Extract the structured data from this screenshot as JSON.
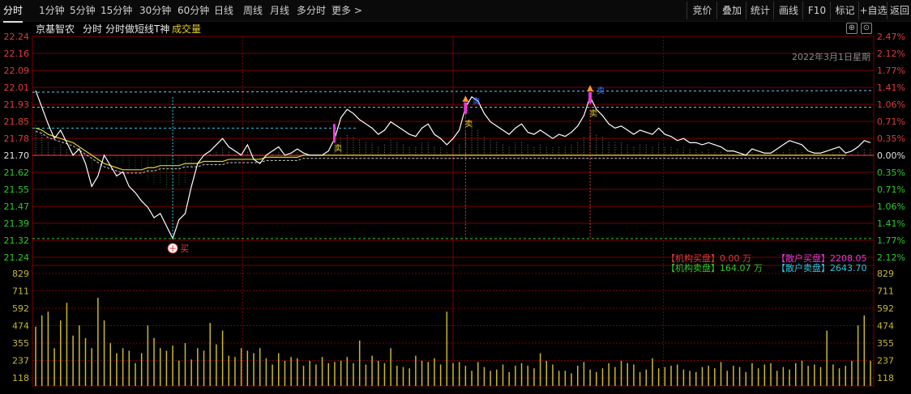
{
  "toolbar": {
    "tabs": [
      "分时",
      "1分钟",
      "5分钟",
      "15分钟",
      "30分钟",
      "60分钟",
      "日线",
      "周线",
      "月线",
      "多分时",
      "更多 >"
    ],
    "buttons": [
      "竞价",
      "叠加",
      "统计",
      "画线",
      "F10",
      "标记",
      "+自选",
      "返回"
    ]
  },
  "info": {
    "stock_name": "京基智农",
    "mode": "分时",
    "indicator": "分时做短线T神",
    "volume_label": "成交量"
  },
  "date_label": "2022年3月1日星期",
  "legend": {
    "inst_buy": "【机构买盘】0.00 万",
    "retail_buy": "【散户买盘】2208.05",
    "inst_sell": "【机构卖盘】164.07 万",
    "retail_sell": "【散户卖盘】2643.70"
  },
  "markers": {
    "buy": "买",
    "sell": "卖",
    "sell_caption": "卖"
  },
  "colors": {
    "up": "#e03c3c",
    "down": "#2ec82e",
    "price_line": "#ffffff",
    "avg_line": "#e8d020",
    "volume": "#c8b832",
    "grid": "#7a0000",
    "accent": "#e83ad8",
    "blue_mark": "#3a78ff"
  },
  "chart_data": {
    "type": "line",
    "prev_close": 21.7,
    "price_ticks": [
      "22.24",
      "22.16",
      "22.09",
      "22.01",
      "21.93",
      "21.85",
      "21.78",
      "21.70",
      "21.62",
      "21.55",
      "21.47",
      "21.39",
      "21.32",
      "21.24"
    ],
    "pct_ticks": [
      "2.47%",
      "2.12%",
      "1.77%",
      "1.41%",
      "1.06%",
      "0.71%",
      "0.35%",
      "0.00%",
      "0.35%",
      "0.71%",
      "1.06%",
      "1.41%",
      "1.77%",
      "2.12%"
    ],
    "volume_ticks": [
      "829",
      "711",
      "592",
      "474",
      "355",
      "237",
      "118"
    ],
    "price_range": [
      21.21,
      22.27
    ],
    "volume_max": 829,
    "series": [
      {
        "name": "price",
        "values": [
          22.01,
          21.93,
          21.85,
          21.78,
          21.82,
          21.76,
          21.7,
          21.73,
          21.66,
          21.55,
          21.6,
          21.7,
          21.65,
          21.6,
          21.62,
          21.55,
          21.52,
          21.48,
          21.45,
          21.4,
          21.42,
          21.36,
          21.3,
          21.39,
          21.42,
          21.55,
          21.66,
          21.7,
          21.72,
          21.75,
          21.78,
          21.74,
          21.72,
          21.7,
          21.75,
          21.68,
          21.66,
          21.7,
          21.72,
          21.74,
          21.7,
          21.71,
          21.73,
          21.71,
          21.7,
          21.7,
          21.7,
          21.72,
          21.78,
          21.88,
          21.92,
          21.9,
          21.87,
          21.85,
          21.83,
          21.8,
          21.82,
          21.86,
          21.84,
          21.82,
          21.8,
          21.79,
          21.83,
          21.85,
          21.8,
          21.78,
          21.75,
          21.78,
          21.82,
          21.93,
          21.98,
          21.96,
          21.9,
          21.86,
          21.84,
          21.82,
          21.8,
          21.83,
          21.85,
          21.81,
          21.8,
          21.82,
          21.8,
          21.78,
          21.8,
          21.79,
          21.81,
          21.84,
          21.89,
          21.98,
          21.92,
          21.89,
          21.85,
          21.83,
          21.84,
          21.82,
          21.8,
          21.82,
          21.81,
          21.8,
          21.83,
          21.8,
          21.79,
          21.77,
          21.78,
          21.76,
          21.76,
          21.75,
          21.76,
          21.75,
          21.74,
          21.72,
          21.72,
          21.71,
          21.7,
          21.73,
          21.72,
          21.71,
          21.71,
          21.73,
          21.75,
          21.77,
          21.76,
          21.75,
          21.72,
          21.71,
          21.71,
          21.72,
          21.73,
          21.74,
          21.71,
          21.72,
          21.74,
          21.77,
          21.76
        ]
      },
      {
        "name": "avg",
        "values": [
          21.83,
          21.82,
          21.8,
          21.79,
          21.78,
          21.77,
          21.76,
          21.74,
          21.72,
          21.7,
          21.68,
          21.66,
          21.65,
          21.64,
          21.63,
          21.63,
          21.63,
          21.63,
          21.64,
          21.64,
          21.65,
          21.65,
          21.65,
          21.65,
          21.66,
          21.66,
          21.66,
          21.67,
          21.67,
          21.67,
          21.67,
          21.68,
          21.68,
          21.68,
          21.68,
          21.68,
          21.68,
          21.69,
          21.69,
          21.69,
          21.69,
          21.69,
          21.69,
          21.7,
          21.7,
          21.7,
          21.7,
          21.7,
          21.7,
          21.7,
          21.7,
          21.7,
          21.7,
          21.7,
          21.7,
          21.7,
          21.7,
          21.7,
          21.7,
          21.7,
          21.7,
          21.7,
          21.7,
          21.7,
          21.7,
          21.7,
          21.7,
          21.7,
          21.7,
          21.7,
          21.7,
          21.7,
          21.7,
          21.7,
          21.7,
          21.7,
          21.7,
          21.7,
          21.7,
          21.7,
          21.7,
          21.7,
          21.7,
          21.7,
          21.7,
          21.7,
          21.7,
          21.7,
          21.7,
          21.7,
          21.7,
          21.7,
          21.7,
          21.7,
          21.7,
          21.7,
          21.7,
          21.7,
          21.7,
          21.7,
          21.7,
          21.7,
          21.7,
          21.7,
          21.7,
          21.7,
          21.7,
          21.7,
          21.7,
          21.7,
          21.7,
          21.7,
          21.7,
          21.7,
          21.7,
          21.7,
          21.7,
          21.7,
          21.7,
          21.7,
          21.7,
          21.7,
          21.7,
          21.7,
          21.7,
          21.7,
          21.7,
          21.7,
          21.7,
          21.7,
          21.7
        ]
      },
      {
        "name": "volume",
        "values": [
          470,
          560,
          590,
          300,
          520,
          660,
          400,
          480,
          380,
          300,
          700,
          520,
          340,
          260,
          300,
          280,
          180,
          260,
          480,
          380,
          300,
          280,
          320,
          200,
          340,
          210,
          300,
          280,
          500,
          330,
          440,
          240,
          230,
          300,
          280,
          260,
          300,
          220,
          170,
          260,
          200,
          230,
          220,
          160,
          200,
          170,
          230,
          180,
          190,
          200,
          230,
          180,
          360,
          170,
          240,
          200,
          180,
          300,
          160,
          150,
          140,
          240,
          200,
          190,
          220,
          170,
          590,
          180,
          190,
          160,
          120,
          190,
          150,
          120,
          130,
          170,
          110,
          160,
          180,
          160,
          140,
          260,
          200,
          170,
          120,
          120,
          100,
          160,
          190,
          130,
          110,
          140,
          180,
          150,
          200,
          180,
          170,
          110,
          130,
          220,
          140,
          150,
          160,
          170,
          130,
          120,
          110,
          150,
          160,
          140,
          190,
          120,
          160,
          150,
          110,
          180,
          140,
          170,
          180,
          120,
          150,
          130,
          180,
          200,
          160,
          170,
          150,
          440,
          170,
          140,
          160,
          200,
          480,
          560,
          200
        ]
      }
    ]
  }
}
